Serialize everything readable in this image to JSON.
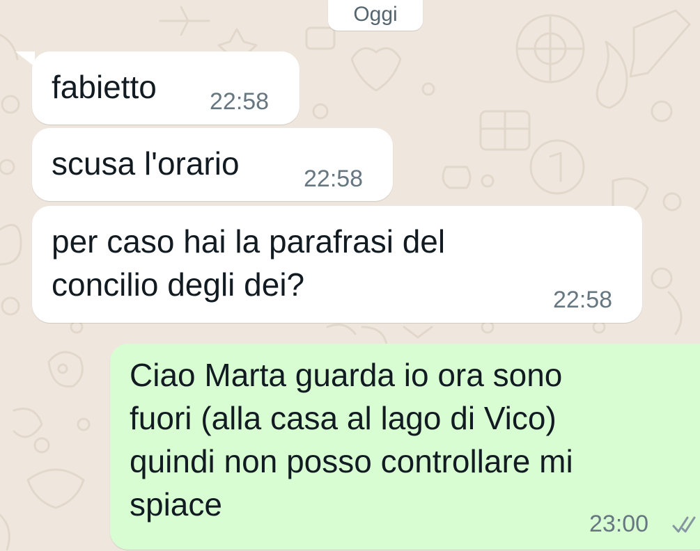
{
  "date_separator": "Oggi",
  "messages": [
    {
      "direction": "incoming",
      "text": "fabietto",
      "time": "22:58"
    },
    {
      "direction": "incoming",
      "text": "scusa l'orario",
      "time": "22:58"
    },
    {
      "direction": "incoming",
      "text": "per caso hai la parafrasi del\nconcilio degli dei?",
      "time": "22:58"
    },
    {
      "direction": "outgoing",
      "text": "Ciao Marta guarda io ora sono\nfuori (alla casa al lago di Vico)\nquindi non posso controllare mi\nspiace",
      "time": "23:00",
      "status": "delivered-double-check-grey"
    }
  ],
  "colors": {
    "wallpaper": "#efe7dd",
    "incoming_bubble": "#ffffff",
    "outgoing_bubble": "#d9fdd3",
    "timestamp": "#667781",
    "text": "#111b21"
  }
}
